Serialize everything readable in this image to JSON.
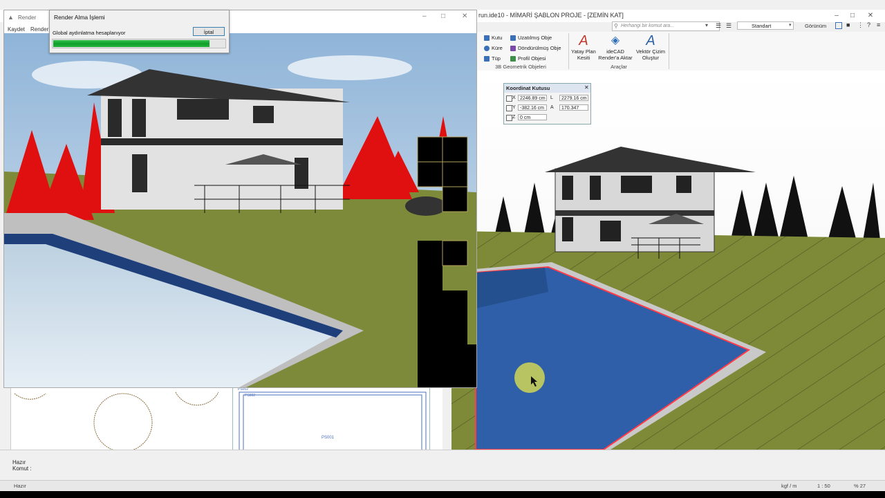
{
  "main_window": {
    "title": "run.ide10 - MİMARİ ŞABLON PROJE - [ZEMİN KAT]",
    "search_placeholder": "Herhangi bir komut ara...",
    "style_select": "Standart",
    "view_menu": "Görünüm"
  },
  "ribbon": {
    "geometric_group": {
      "label": "3B Geometrik Objeleri",
      "items": [
        "Kutu",
        "Küre",
        "Tüp",
        "Uzatılmış Obje",
        "Döndürülmüş Obje",
        "Profil Objesi"
      ]
    },
    "tools_group": {
      "label": "Araçlar",
      "buttons": [
        {
          "line1": "Yatay Plan",
          "line2": "Kesiti"
        },
        {
          "line1": "ideCAD",
          "line2": "Render'a Aktar"
        },
        {
          "line1": "Vektör Çizim",
          "line2": "Oluştur"
        }
      ]
    }
  },
  "coord_box": {
    "title": "Koordinat Kutusu",
    "x_label": "X",
    "x_value": "2246.89 cm",
    "l_label": "L",
    "l_value": "2279.16 cm",
    "y_label": "Y",
    "y_value": "-382.16 cm",
    "a_label": "A",
    "a_value": "170.347",
    "z_label": "Z",
    "z_value": "0 cm"
  },
  "render_window": {
    "title": "Render",
    "menu": [
      "Kaydet",
      "Render"
    ]
  },
  "progress_dialog": {
    "title": "Render Alma İşlemi",
    "message": "Global aydınlatma hesaplanıyor",
    "cancel_label": "İptal",
    "progress": 0.91
  },
  "plan_panel": {
    "label_top": "PS002",
    "label_inner": "PS002",
    "label_center": "PS001"
  },
  "command": {
    "status": "Hazır",
    "prompt": "Komut :"
  },
  "status_bar": {
    "left": "Hazır",
    "units": "kgf / m",
    "scale": "1 : 50",
    "zoom": "% 27"
  },
  "colors": {
    "progress_green": "#0ea02a",
    "pool_blue": "#2e5fa8",
    "grass": "#7f8a38",
    "foliage_red": "#e01010",
    "pool_edge_red": "#ff3b4a"
  }
}
